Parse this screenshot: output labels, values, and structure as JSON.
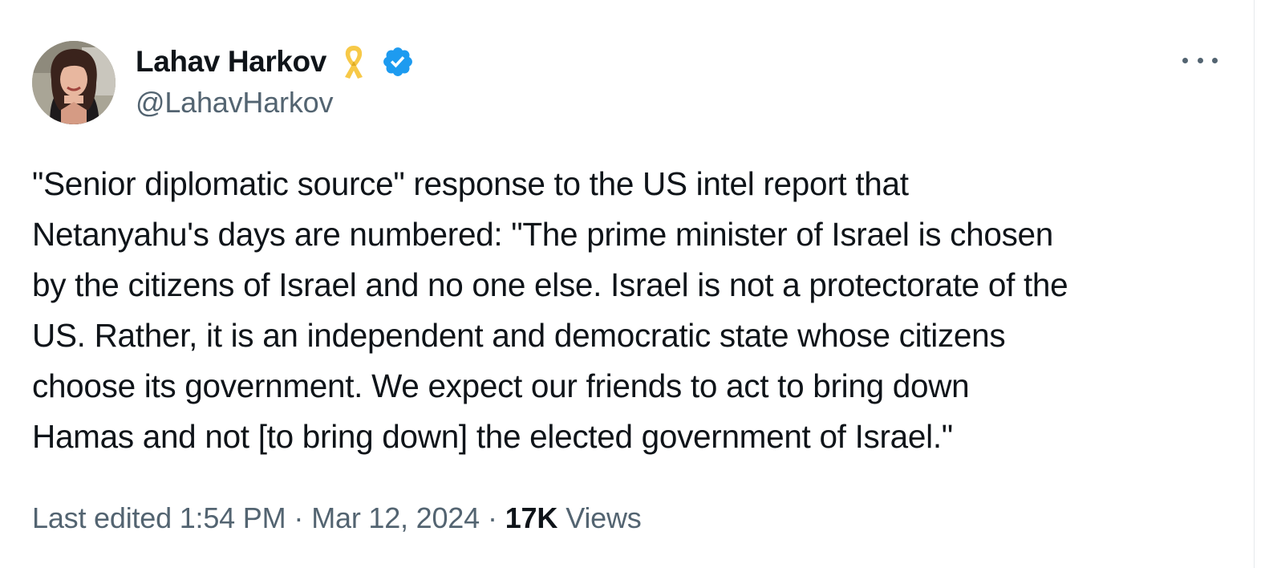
{
  "author": {
    "display_name": "Lahav Harkov",
    "handle": "@LahavHarkov",
    "badges": [
      "yellow-ribbon-icon",
      "verified-badge-icon"
    ],
    "verified_color": "#1d9bf0"
  },
  "tweet": {
    "text": "\"Senior diplomatic source\" response to the US intel report that\nNetanyahu's days are numbered: \"The prime minister of Israel is chosen\nby the citizens of Israel and no one else. Israel is not a protectorate of the\nUS. Rather, it is an independent and democratic state whose citizens\nchoose its government. We expect our friends to act to bring down\nHamas and not [to bring down] the elected government of Israel.\""
  },
  "meta": {
    "edited_label": "Last edited 1:54 PM",
    "separator": "·",
    "date": "Mar 12, 2024",
    "views_count": "17K",
    "views_label": "Views"
  },
  "colors": {
    "text_primary": "#0f1419",
    "text_secondary": "#536471",
    "ribbon": "#f7c948"
  },
  "icons": {
    "more": "more-options-icon"
  }
}
